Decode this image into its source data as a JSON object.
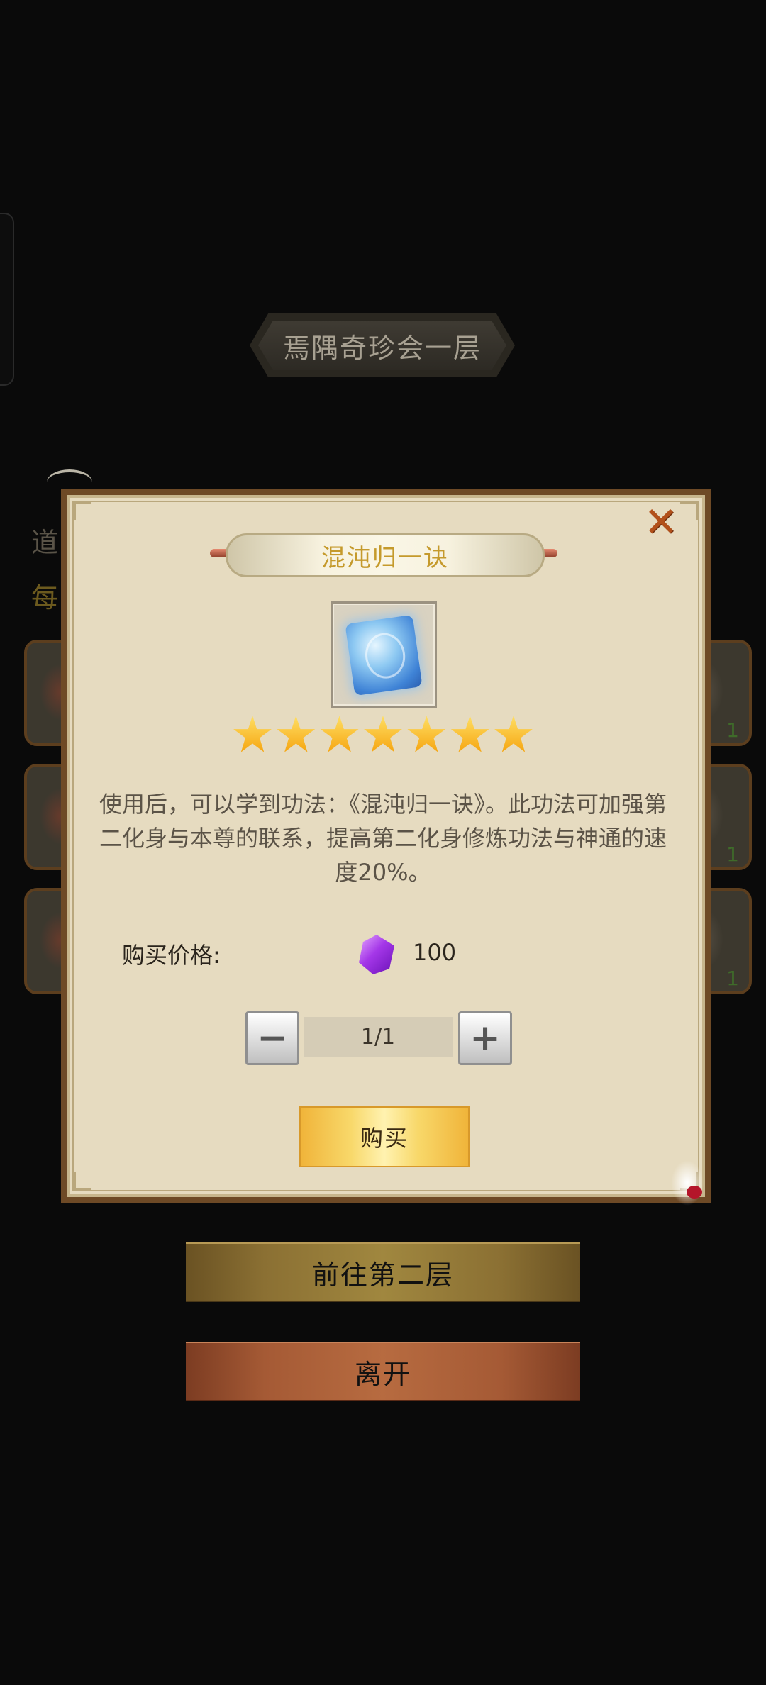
{
  "top_title": "焉隅奇珍会一层",
  "background": {
    "line1": "道",
    "line2": "每",
    "rows": [
      {
        "count": "1"
      },
      {
        "count": "1"
      },
      {
        "count": "1"
      }
    ]
  },
  "modal": {
    "item_name": "混沌归一诀",
    "star_count": 7,
    "description": "使用后，可以学到功法：《混沌归一诀》。此功法可加强第二化身与本尊的联系，提高第二化身修炼功法与神通的速度20%。",
    "price_label": "购买价格:",
    "price_value": "100",
    "currency_icon": "purple-gem-icon",
    "quantity": "1/1",
    "minus_label": "−",
    "plus_label": "+",
    "buy_label": "购买",
    "close_label": "✕"
  },
  "buttons": {
    "next_floor": "前往第二层",
    "leave": "离开"
  },
  "colors": {
    "modal_bg": "#e6dbc0",
    "modal_border": "#6e4a26",
    "item_name": "#c59a2c",
    "close": "#b2501a",
    "buy_button": "#f8d86a"
  }
}
